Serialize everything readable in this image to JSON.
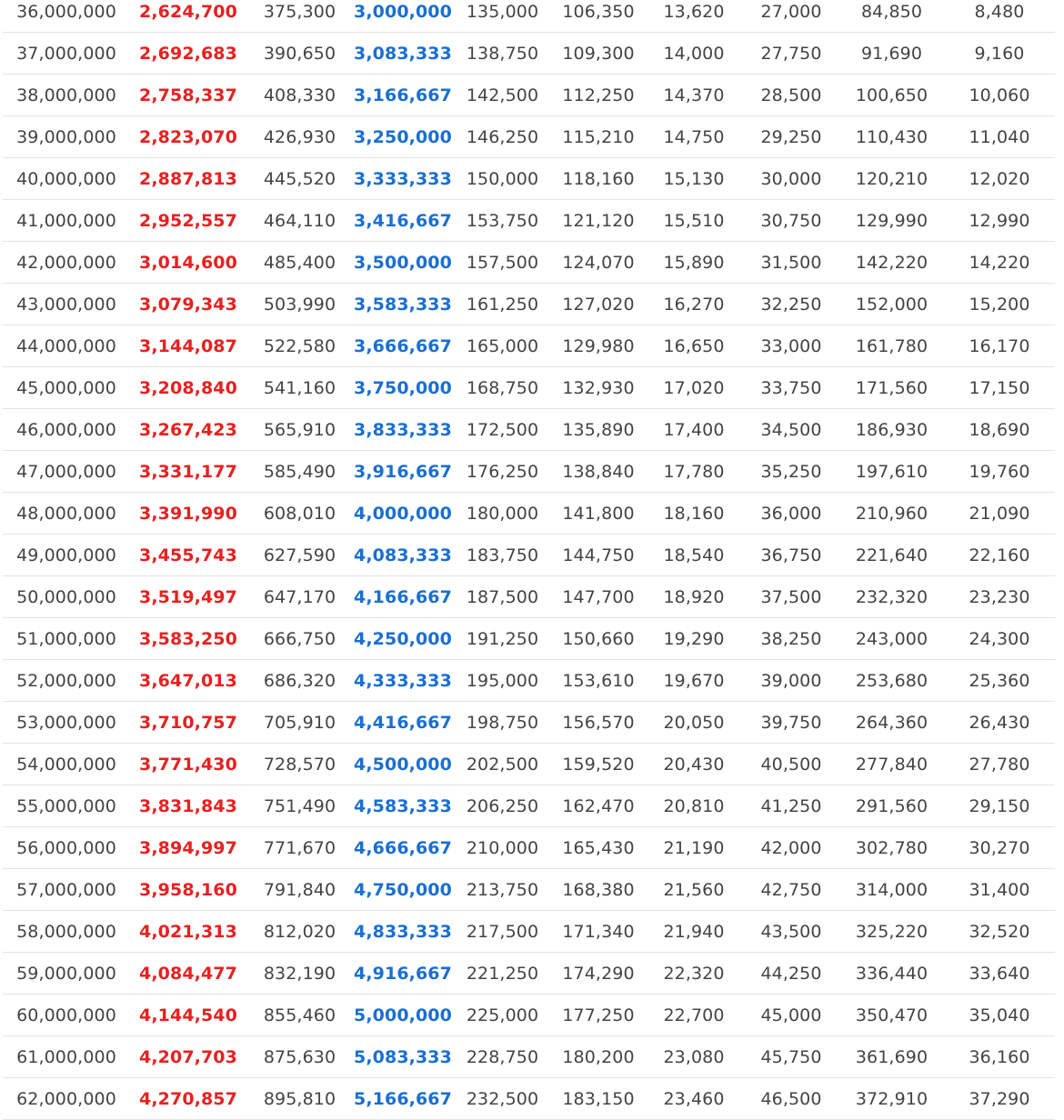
{
  "colors": {
    "text": "#444444",
    "highlight_red": "#e82020",
    "highlight_blue": "#1a6fd2",
    "row_divider": "#e3e3e3"
  },
  "table": {
    "rows": [
      [
        "36,000,000",
        "2,624,700",
        "375,300",
        "3,000,000",
        "135,000",
        "106,350",
        "13,620",
        "27,000",
        "84,850",
        "8,480"
      ],
      [
        "37,000,000",
        "2,692,683",
        "390,650",
        "3,083,333",
        "138,750",
        "109,300",
        "14,000",
        "27,750",
        "91,690",
        "9,160"
      ],
      [
        "38,000,000",
        "2,758,337",
        "408,330",
        "3,166,667",
        "142,500",
        "112,250",
        "14,370",
        "28,500",
        "100,650",
        "10,060"
      ],
      [
        "39,000,000",
        "2,823,070",
        "426,930",
        "3,250,000",
        "146,250",
        "115,210",
        "14,750",
        "29,250",
        "110,430",
        "11,040"
      ],
      [
        "40,000,000",
        "2,887,813",
        "445,520",
        "3,333,333",
        "150,000",
        "118,160",
        "15,130",
        "30,000",
        "120,210",
        "12,020"
      ],
      [
        "41,000,000",
        "2,952,557",
        "464,110",
        "3,416,667",
        "153,750",
        "121,120",
        "15,510",
        "30,750",
        "129,990",
        "12,990"
      ],
      [
        "42,000,000",
        "3,014,600",
        "485,400",
        "3,500,000",
        "157,500",
        "124,070",
        "15,890",
        "31,500",
        "142,220",
        "14,220"
      ],
      [
        "43,000,000",
        "3,079,343",
        "503,990",
        "3,583,333",
        "161,250",
        "127,020",
        "16,270",
        "32,250",
        "152,000",
        "15,200"
      ],
      [
        "44,000,000",
        "3,144,087",
        "522,580",
        "3,666,667",
        "165,000",
        "129,980",
        "16,650",
        "33,000",
        "161,780",
        "16,170"
      ],
      [
        "45,000,000",
        "3,208,840",
        "541,160",
        "3,750,000",
        "168,750",
        "132,930",
        "17,020",
        "33,750",
        "171,560",
        "17,150"
      ],
      [
        "46,000,000",
        "3,267,423",
        "565,910",
        "3,833,333",
        "172,500",
        "135,890",
        "17,400",
        "34,500",
        "186,930",
        "18,690"
      ],
      [
        "47,000,000",
        "3,331,177",
        "585,490",
        "3,916,667",
        "176,250",
        "138,840",
        "17,780",
        "35,250",
        "197,610",
        "19,760"
      ],
      [
        "48,000,000",
        "3,391,990",
        "608,010",
        "4,000,000",
        "180,000",
        "141,800",
        "18,160",
        "36,000",
        "210,960",
        "21,090"
      ],
      [
        "49,000,000",
        "3,455,743",
        "627,590",
        "4,083,333",
        "183,750",
        "144,750",
        "18,540",
        "36,750",
        "221,640",
        "22,160"
      ],
      [
        "50,000,000",
        "3,519,497",
        "647,170",
        "4,166,667",
        "187,500",
        "147,700",
        "18,920",
        "37,500",
        "232,320",
        "23,230"
      ],
      [
        "51,000,000",
        "3,583,250",
        "666,750",
        "4,250,000",
        "191,250",
        "150,660",
        "19,290",
        "38,250",
        "243,000",
        "24,300"
      ],
      [
        "52,000,000",
        "3,647,013",
        "686,320",
        "4,333,333",
        "195,000",
        "153,610",
        "19,670",
        "39,000",
        "253,680",
        "25,360"
      ],
      [
        "53,000,000",
        "3,710,757",
        "705,910",
        "4,416,667",
        "198,750",
        "156,570",
        "20,050",
        "39,750",
        "264,360",
        "26,430"
      ],
      [
        "54,000,000",
        "3,771,430",
        "728,570",
        "4,500,000",
        "202,500",
        "159,520",
        "20,430",
        "40,500",
        "277,840",
        "27,780"
      ],
      [
        "55,000,000",
        "3,831,843",
        "751,490",
        "4,583,333",
        "206,250",
        "162,470",
        "20,810",
        "41,250",
        "291,560",
        "29,150"
      ],
      [
        "56,000,000",
        "3,894,997",
        "771,670",
        "4,666,667",
        "210,000",
        "165,430",
        "21,190",
        "42,000",
        "302,780",
        "30,270"
      ],
      [
        "57,000,000",
        "3,958,160",
        "791,840",
        "4,750,000",
        "213,750",
        "168,380",
        "21,560",
        "42,750",
        "314,000",
        "31,400"
      ],
      [
        "58,000,000",
        "4,021,313",
        "812,020",
        "4,833,333",
        "217,500",
        "171,340",
        "21,940",
        "43,500",
        "325,220",
        "32,520"
      ],
      [
        "59,000,000",
        "4,084,477",
        "832,190",
        "4,916,667",
        "221,250",
        "174,290",
        "22,320",
        "44,250",
        "336,440",
        "33,640"
      ],
      [
        "60,000,000",
        "4,144,540",
        "855,460",
        "5,000,000",
        "225,000",
        "177,250",
        "22,700",
        "45,000",
        "350,470",
        "35,040"
      ],
      [
        "61,000,000",
        "4,207,703",
        "875,630",
        "5,083,333",
        "228,750",
        "180,200",
        "23,080",
        "45,750",
        "361,690",
        "36,160"
      ],
      [
        "62,000,000",
        "4,270,857",
        "895,810",
        "5,166,667",
        "232,500",
        "183,150",
        "23,460",
        "46,500",
        "372,910",
        "37,290"
      ]
    ]
  }
}
